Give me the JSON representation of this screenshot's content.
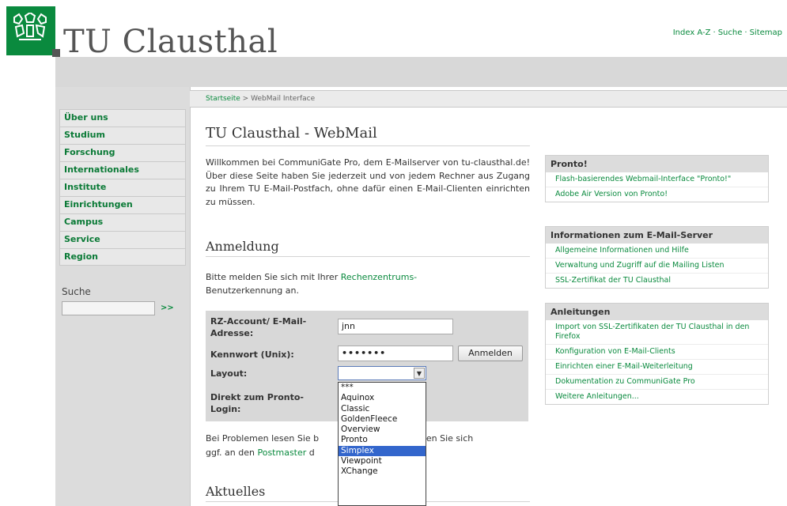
{
  "header": {
    "site_title": "TU Clausthal",
    "top_links": [
      "Index A-Z",
      "Suche",
      "Sitemap"
    ],
    "brand_color": "#0a8a3e"
  },
  "breadcrumb": {
    "home": "Startseite",
    "separator": ">",
    "current": "WebMail Interface"
  },
  "nav": {
    "items": [
      "Über uns",
      "Studium",
      "Forschung",
      "Internationales",
      "Institute",
      "Einrichtungen",
      "Campus",
      "Service",
      "Region"
    ]
  },
  "search": {
    "label": "Suche",
    "value": "",
    "go_label": ">>"
  },
  "main": {
    "title": "TU Clausthal - WebMail",
    "intro": "Willkommen bei CommuniGate Pro, dem E-Mailserver von tu-clausthal.de! Über diese Seite haben Sie jederzeit und von jedem Rechner aus Zugang zu Ihrem TU E-Mail-Postfach, ohne dafür einen E-Mail-Clienten einrichten zu müssen.",
    "login_heading": "Anmeldung",
    "login_note_prefix": "Bitte melden Sie sich mit Ihrer ",
    "login_note_link": "Rechenzentrums-",
    "login_note_suffix": "Benutzerkennung an.",
    "problem_prefix": "Bei Problemen lesen Sie b",
    "problem_middle": "wenden Sie sich",
    "problem_line2_prefix": "ggf. an den ",
    "problem_link": "Postmaster",
    "problem_line2_suffix": " d",
    "news_heading": "Aktuelles"
  },
  "form": {
    "account_label": "RZ-Account/ E-Mail-Adresse:",
    "account_value": "jnn",
    "password_label": "Kennwort (Unix):",
    "password_value": "•••••••",
    "login_button": "Anmelden",
    "layout_label": "Layout:",
    "layout_value": "",
    "pronto_label": "Direkt zum Pronto-Login:",
    "layout_options": [
      "***",
      "Aquinox",
      "Classic",
      "GoldenFleece",
      "Overview",
      "Pronto",
      "Simplex",
      "Viewpoint",
      "XChange"
    ],
    "highlighted_option": "Simplex"
  },
  "sidebar": {
    "boxes": [
      {
        "title": "Pronto!",
        "links": [
          "Flash-basierendes Webmail-Interface \"Pronto!\"",
          "Adobe Air Version von Pronto!"
        ]
      },
      {
        "title": "Informationen zum E-Mail-Server",
        "links": [
          "Allgemeine Informationen und Hilfe",
          "Verwaltung und Zugriff auf die Mailing Listen",
          "SSL-Zertifikat der TU Clausthal"
        ]
      },
      {
        "title": "Anleitungen",
        "links": [
          "Import von SSL-Zertifikaten der TU Clausthal in den Firefox",
          "Konfiguration von E-Mail-Clients",
          "Einrichten einer E-Mail-Weiterleitung",
          "Dokumentation zu CommuniGate Pro",
          "Weitere Anleitungen..."
        ]
      }
    ]
  }
}
